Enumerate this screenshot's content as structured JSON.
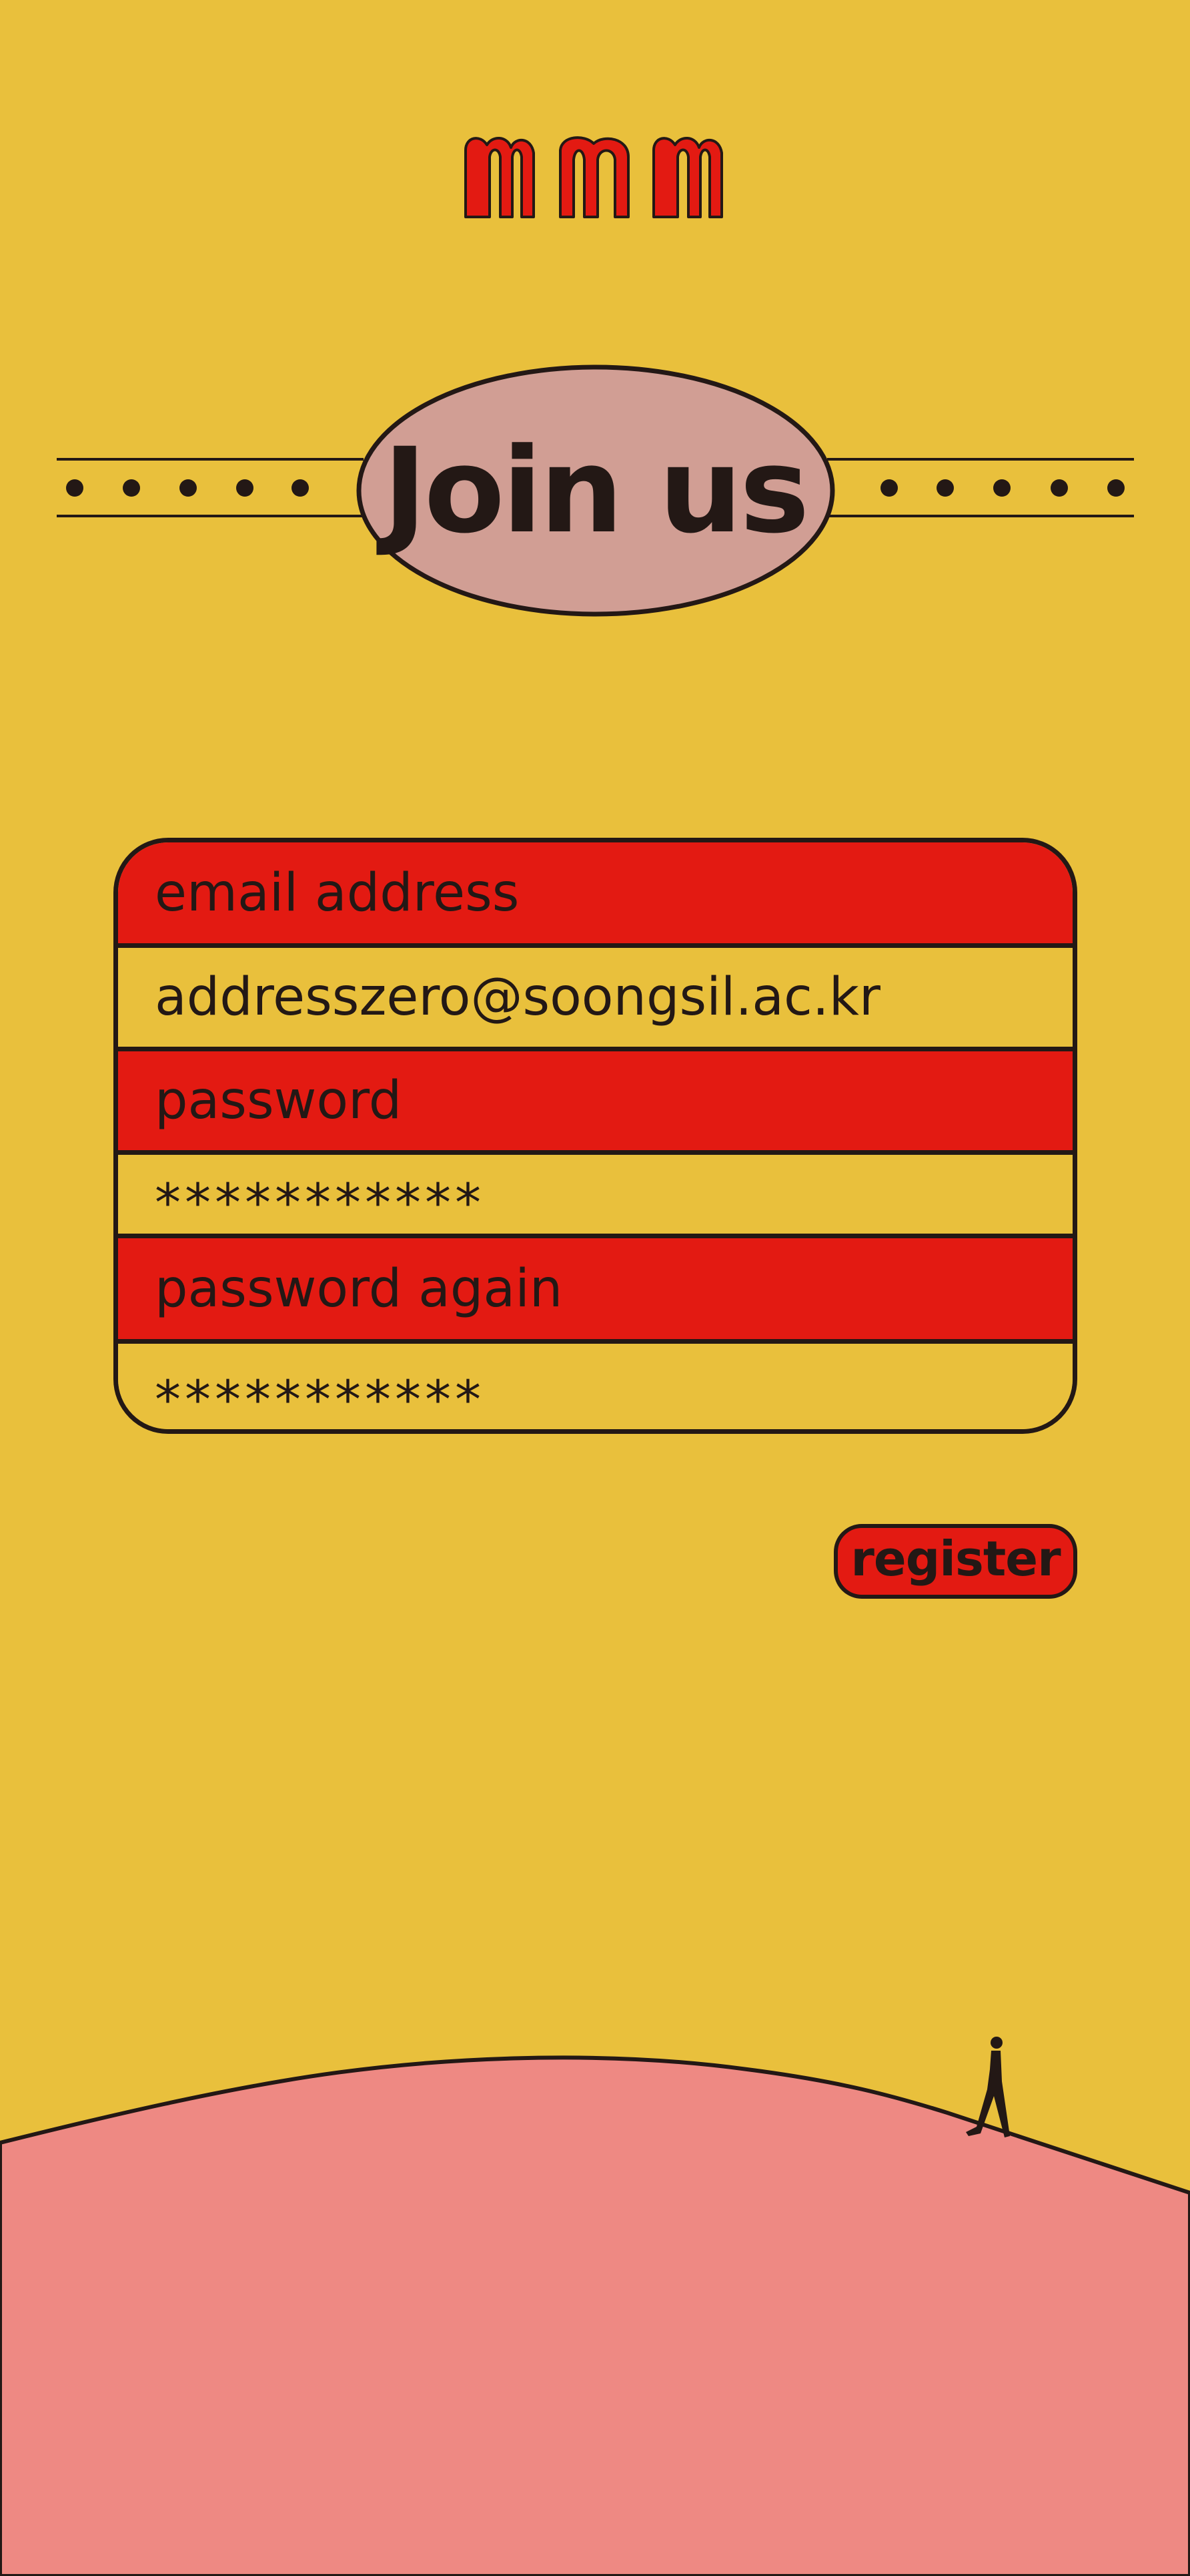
{
  "brand": {
    "logo_text": "mnm"
  },
  "hero": {
    "title": "Join us"
  },
  "form": {
    "email_label": "email address",
    "email_value": "addresszero@soongsil.ac.kr",
    "password_label": "password",
    "password_value": "***********",
    "password_again_label": "password again",
    "password_again_value": "***********"
  },
  "actions": {
    "register_label": "register"
  },
  "colors": {
    "background": "#E9C03C",
    "accent_red": "#E31A12",
    "oval_pink": "#D19E94",
    "hill_pink": "#EE8983",
    "ink": "#231815"
  }
}
